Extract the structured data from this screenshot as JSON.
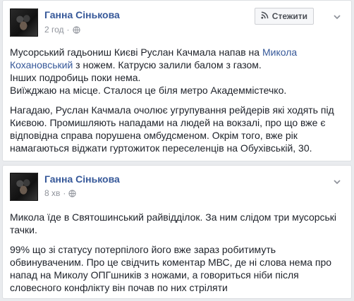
{
  "posts": [
    {
      "author": "Ганна Сінькова",
      "time": "2 год",
      "follow_label": "Стежити",
      "p1": {
        "pre": "Мусорський гадьониш Києві Руслан Качмала напав на ",
        "link": "Микола Кохановський",
        "post": " з ножем. Катрусю залили балом з газом.",
        "line2": "Інших подробиць поки нема.",
        "line3": "Виїжджаю на місце. Сталося це біля метро Академмістечко."
      },
      "p2": "Нагадаю, Руслан Качмала очолює угрупування рейдерів які ходять під Києвою. Промишляють нападами на людей на вокзалі, про що вже є відповідна справа порушена омбудсменом. Окрім того, вже рік намагаються віджати гуртожиток переселенців на Обухівській, 30."
    },
    {
      "author": "Ганна Сінькова",
      "time": "8 хв",
      "p1": "Микола їде в Святошинський райвідділок. За ним слідом три мусорські тачки.",
      "p2": "99% що зі статусу потерпілого його вже зараз робитимуть обвинуваченим. Про це свідчить коментар МВС, де ні слова нема про напад на Миколу ОПГшників з ножами, а говориться ніби після словесного конфлікту він почав по них стріляти"
    }
  ],
  "icons": {
    "globe": "globe-icon",
    "rss": "rss-icon",
    "chevron": "chevron-down-icon"
  }
}
